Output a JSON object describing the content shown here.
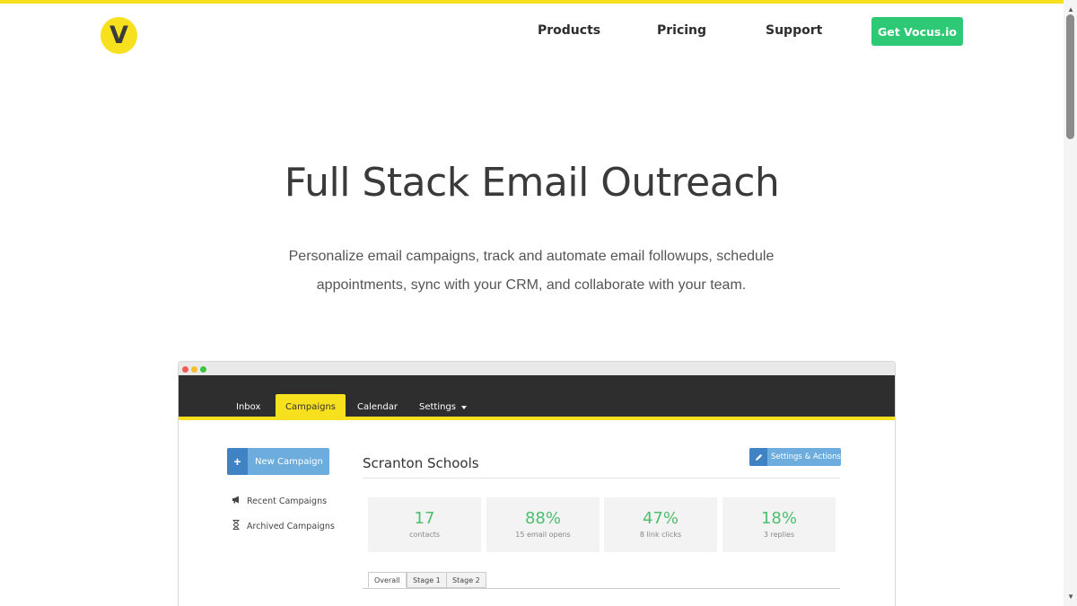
{
  "header": {
    "logo_letter": "V",
    "nav": [
      "Products",
      "Pricing",
      "Support"
    ],
    "cta_label": "Get Vocus.io"
  },
  "hero": {
    "title": "Full Stack Email Outreach",
    "subtitle_line1": "Personalize email campaigns, track and automate email followups, schedule",
    "subtitle_line2": "appointments, sync with your CRM, and collaborate with your team."
  },
  "mockup": {
    "tabs": [
      "Inbox",
      "Campaigns",
      "Calendar",
      "Settings"
    ],
    "active_tab": "Campaigns",
    "new_campaign_label": "New Campaign",
    "sidebar": [
      "Recent Campaigns",
      "Archived Campaigns"
    ],
    "campaign_title": "Scranton Schools",
    "settings_label": "Settings & Actions",
    "stats": [
      {
        "value": "17",
        "label": "contacts"
      },
      {
        "value": "88%",
        "label": "15 email opens"
      },
      {
        "value": "47%",
        "label": "8 link clicks"
      },
      {
        "value": "18%",
        "label": "3 replies"
      }
    ],
    "stage_tabs": [
      "Overall",
      "Stage 1",
      "Stage 2"
    ]
  },
  "colors": {
    "brand_yellow": "#f7e01d",
    "cta_green": "#2ec975",
    "stat_green": "#4dbf6e",
    "app_blue": "#6cadde"
  }
}
